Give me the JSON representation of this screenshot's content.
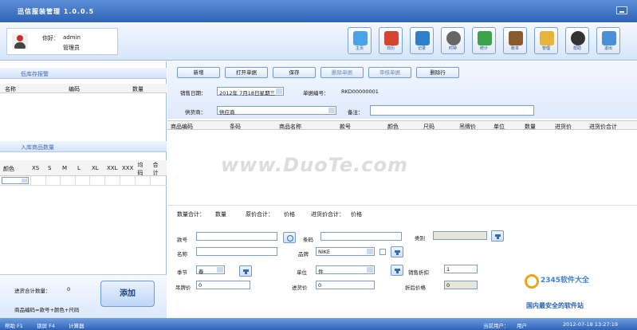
{
  "title": "迅信服装管理 1.0.0.5",
  "user": {
    "greeting": "你好：",
    "name": "admin",
    "role": "管理员"
  },
  "toolbar": [
    {
      "label": "主页",
      "icon": "home-icon",
      "color": "#4aa3e8"
    },
    {
      "label": "日历",
      "icon": "calendar-icon",
      "color": "#d8432f"
    },
    {
      "label": "记录",
      "icon": "record-icon",
      "color": "#2f7ec9"
    },
    {
      "label": "时钟",
      "icon": "clock-icon",
      "color": "#666666"
    },
    {
      "label": "统计",
      "icon": "chart-icon",
      "color": "#3aa34a"
    },
    {
      "label": "账本",
      "icon": "book-icon",
      "color": "#8b5a2b"
    },
    {
      "label": "管理",
      "icon": "manage-icon",
      "color": "#e8b33a"
    },
    {
      "label": "帮助",
      "icon": "help-icon",
      "color": "#333333"
    },
    {
      "label": "退出",
      "icon": "exit-icon",
      "color": "#4a8fd8"
    }
  ],
  "left": {
    "low_stock_title": "低库存报警",
    "low_stock_cols": [
      "名称",
      "编码",
      "数量"
    ],
    "inbound_title": "入库商品数量",
    "size_cols": [
      "颜色",
      "XS",
      "S",
      "M",
      "L",
      "XL",
      "XXL",
      "XXX",
      "均码",
      "合计"
    ],
    "total_label": "进货合计数量：",
    "total_value": "0",
    "formula": "商品编码=款号+颜色+尺码",
    "add_label": "添加"
  },
  "actions": [
    {
      "label": "新增",
      "enabled": true
    },
    {
      "label": "打开单据",
      "enabled": true
    },
    {
      "label": "保存",
      "enabled": true
    },
    {
      "label": "删除单据",
      "enabled": false
    },
    {
      "label": "审核单据",
      "enabled": false
    },
    {
      "label": "删除行",
      "enabled": true
    }
  ],
  "form": {
    "date_label": "销售日期：",
    "date_value": "2012年 7月18日星期三",
    "docno_label": "单据编号：",
    "docno_value": "RKD00000001",
    "supplier_label": "供货商：",
    "supplier_value": "供应商",
    "note_label": "备注："
  },
  "columns": [
    "商品编码",
    "条码",
    "商品名称",
    "款号",
    "颜色",
    "尺码",
    "吊牌价",
    "单位",
    "数量",
    "进货价",
    "进货价合计"
  ],
  "summary": [
    {
      "label": "数量合计：",
      "value": "数量"
    },
    {
      "label": "原价合计：",
      "value": "价格"
    },
    {
      "label": "进货价合计：",
      "value": "价格"
    }
  ],
  "detail": {
    "style_no": "款号",
    "barcode": "条码",
    "category": "类别",
    "name": "名称",
    "brand": "品牌",
    "brand_value": "NIKE",
    "season": "季节",
    "season_value": "春",
    "unit": "单位",
    "unit_value": "件",
    "discount": "销售折扣",
    "discount_value": "1",
    "tag_price": "吊牌价",
    "tag_price_value": "0",
    "purchase_price": "进货价",
    "purchase_price_value": "0",
    "after_discount": "折后价格",
    "after_discount_value": "0"
  },
  "status": {
    "help": "帮助 F1",
    "lock": "锁屏 F4",
    "calc": "计算器",
    "current_user_label": "当前用户：",
    "current_user": "用户",
    "datetime": "2012-07-18 13:27:19"
  },
  "watermark": "www.DuoTe.com",
  "site": {
    "name": "2345软件大全",
    "slogan": "国内最安全的软件站"
  }
}
